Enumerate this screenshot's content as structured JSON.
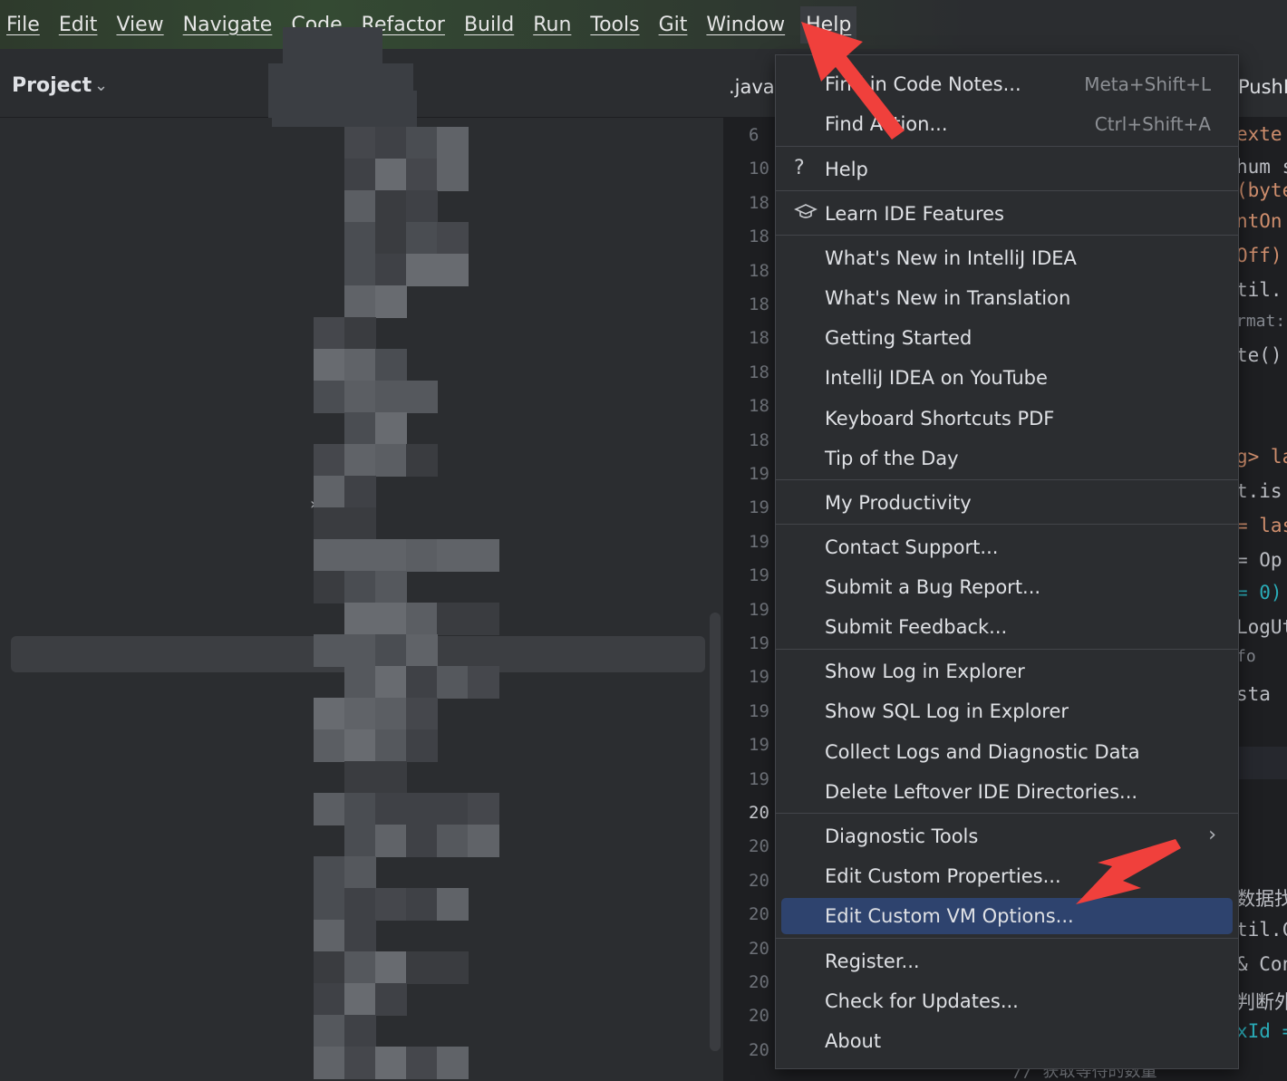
{
  "menubar": {
    "items": [
      "File",
      "Edit",
      "View",
      "Navigate",
      "Code",
      "Refactor",
      "Build",
      "Run",
      "Tools",
      "Git",
      "Window",
      "Help"
    ]
  },
  "project": {
    "title": "Project"
  },
  "editor": {
    "tab_left": ".java",
    "tab_right": "PushI",
    "line_numbers": [
      "6",
      "10",
      "18",
      "18",
      "18",
      "18",
      "18",
      "18",
      "18",
      "18",
      "19",
      "19",
      "19",
      "19",
      "19",
      "19",
      "19",
      "19",
      "19",
      "19",
      "20",
      "20",
      "20",
      "20",
      "20",
      "20",
      "20",
      "20"
    ],
    "code_fragments": [
      "exte",
      "hum s",
      "(byte",
      "ntOn",
      "Off)",
      "til.",
      "rmat:",
      "te()",
      "g> la",
      "t.is",
      "= las",
      "= Op",
      "= 0)",
      "LogUt",
      "fo",
      "sta",
      "数据找",
      "til.C",
      "& Con",
      "判断外",
      "xId =",
      "// 获取等待的数量"
    ]
  },
  "help_menu": {
    "items": [
      {
        "label": "Find in Code Notes...",
        "shortcut": "Meta+Shift+L"
      },
      {
        "label": "Find Action...",
        "shortcut": "Ctrl+Shift+A"
      },
      {
        "label": "Help",
        "icon": "question-icon"
      },
      {
        "label": "Learn IDE Features",
        "icon": "graduation-cap-icon"
      },
      {
        "label": "What's New in IntelliJ IDEA"
      },
      {
        "label": "What's New in Translation"
      },
      {
        "label": "Getting Started"
      },
      {
        "label": "IntelliJ IDEA on YouTube"
      },
      {
        "label": "Keyboard Shortcuts PDF"
      },
      {
        "label": "Tip of the Day"
      },
      {
        "label": "My Productivity"
      },
      {
        "label": "Contact Support..."
      },
      {
        "label": "Submit a Bug Report..."
      },
      {
        "label": "Submit Feedback..."
      },
      {
        "label": "Show Log in Explorer"
      },
      {
        "label": "Show SQL Log in Explorer"
      },
      {
        "label": "Collect Logs and Diagnostic Data"
      },
      {
        "label": "Delete Leftover IDE Directories..."
      },
      {
        "label": "Diagnostic Tools",
        "submenu": "chevron-right-icon"
      },
      {
        "label": "Edit Custom Properties..."
      },
      {
        "label": "Edit Custom VM Options...",
        "selected": true
      },
      {
        "label": "Register..."
      },
      {
        "label": "Check for Updates..."
      },
      {
        "label": "About"
      }
    ]
  },
  "colors": {
    "selection": "#2e436e",
    "arrow": "#f0403c",
    "menu_bg": "#2b2d30"
  }
}
